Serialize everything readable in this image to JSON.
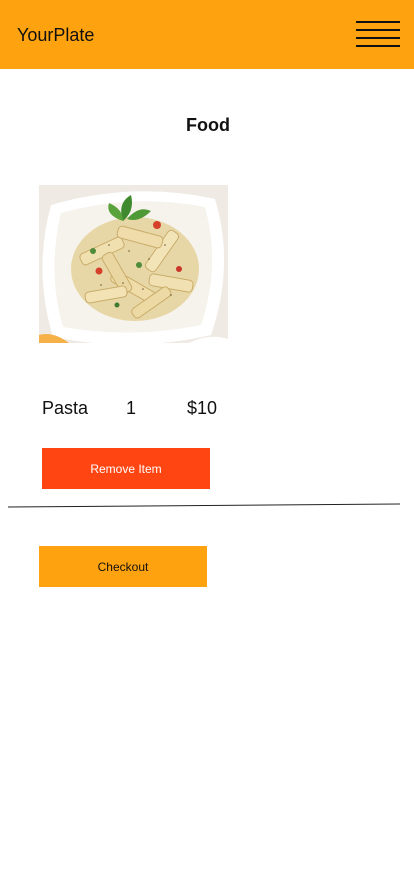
{
  "header": {
    "brand": "YourPlate",
    "menu_icon": "hamburger-menu-icon",
    "background_color": "#ffa20f"
  },
  "page": {
    "title": "Food"
  },
  "cart": {
    "items": [
      {
        "name": "Pasta",
        "quantity": "1",
        "price": "$10",
        "image": "pasta-dish-photo"
      }
    ],
    "remove_label": "Remove Item",
    "remove_color": "#ff4512"
  },
  "checkout": {
    "label": "Checkout",
    "color": "#ffa20f"
  }
}
